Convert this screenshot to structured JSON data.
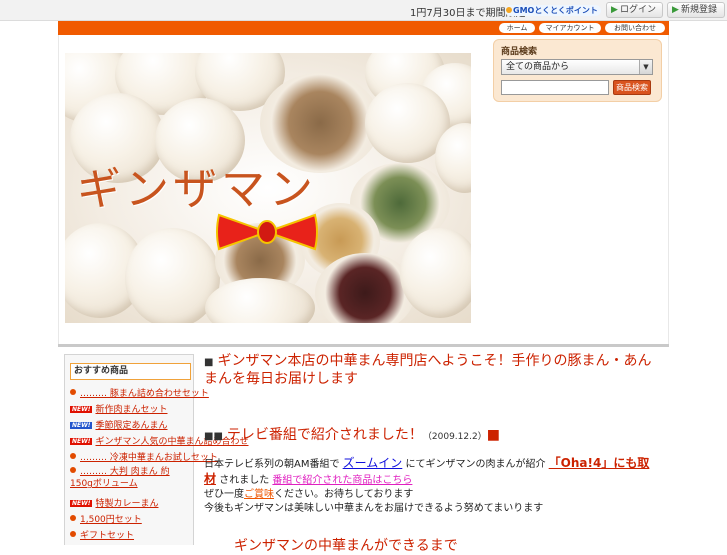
{
  "topbar": {
    "message": "1円7月30日まで期間限定",
    "gmo_badge": "GMOとくとくポイント",
    "login_label": "ログイン",
    "signup_label": "新規登録"
  },
  "nav": {
    "home": "ホーム",
    "account": "マイアカウント",
    "contact": "お問い合わせ"
  },
  "hero": {
    "title": "ギンザマン"
  },
  "search": {
    "title": "商品検索",
    "category_value": "全ての商品から",
    "query_value": "",
    "button_label": "商品検索"
  },
  "sidebar": {
    "title": "おすすめ商品",
    "items": [
      {
        "label": "……… 豚まん詰め合わせセット",
        "badge": ""
      },
      {
        "label": "新作肉まんセット",
        "badge": "new"
      },
      {
        "label": "季節限定あんまん",
        "badge": "new-blue"
      },
      {
        "label": "ギンザマン人気の中華まん詰め合わせ",
        "badge": "new"
      },
      {
        "label": "……… 冷凍中華まんお試しセット",
        "badge": ""
      },
      {
        "label": "……… 大判 肉まん 約150gボリューム",
        "badge": ""
      },
      {
        "label": "特製カレーまん",
        "badge": "new"
      },
      {
        "label": "1,500円セット",
        "badge": ""
      },
      {
        "label": "ギフトセット",
        "badge": ""
      }
    ]
  },
  "content": {
    "headline": "ギンザマン本店の中華まん専門店へようこそ！手作りの豚まん・あんまんを毎日お届けします",
    "news_title": "テレビ番組で紹介されました！",
    "news_date": "（2009.12.2）",
    "body_prefix": "日本テレビ系列の朝AM番組で",
    "body_program": "ズームイン",
    "body_mid": "にてギンザマンの肉まんが紹介",
    "body_oha": "「Oha!4」にも取材",
    "body_after": "されました",
    "body_link1": "番組で紹介された商品はこちら",
    "body_line2_prefix": "ぜひ一度",
    "body_line2_link": "ご賞味",
    "body_line2_suffix": "ください。お待ちしております",
    "body_line3": "今後もギンザマンは美味しい中華まんをお届けできるよう努めてまいります",
    "footer_heading": "ギンザマンの中華まんができるまで"
  }
}
